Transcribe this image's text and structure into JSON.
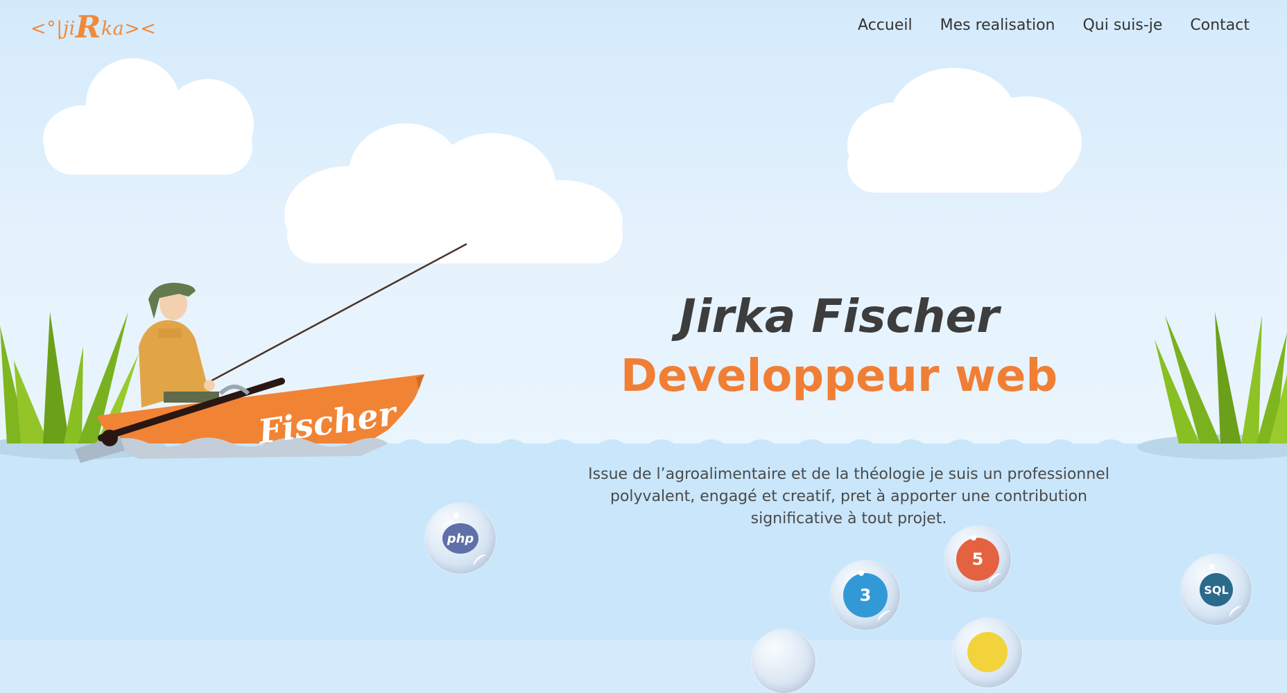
{
  "header": {
    "logo_left": "<°|ji",
    "logo_big": "R",
    "logo_right": "ka><",
    "nav": [
      {
        "label": "Accueil"
      },
      {
        "label": "Mes realisation"
      },
      {
        "label": "Qui suis-je"
      },
      {
        "label": "Contact"
      }
    ]
  },
  "hero": {
    "name": "Jirka Fischer",
    "role": "Developpeur web",
    "description": "Issue de l’agroalimentaire et de la théologie je suis un professionnel polyvalent, engagé et creatif, pret à apporter une contribution significative à tout projet."
  },
  "illustration": {
    "boat_label": "Fischer"
  },
  "skills": [
    {
      "label": "php",
      "color": "#5f6fa8"
    },
    {
      "label": "5",
      "color": "#e4623f"
    },
    {
      "label": "3",
      "color": "#3399d6"
    },
    {
      "label": "SQL",
      "color": "#2a6a8a"
    }
  ],
  "colors": {
    "accent": "#f07f35",
    "text": "#3d3d3d",
    "sky": "#e4f2fd",
    "water": "#c9e6fb"
  }
}
